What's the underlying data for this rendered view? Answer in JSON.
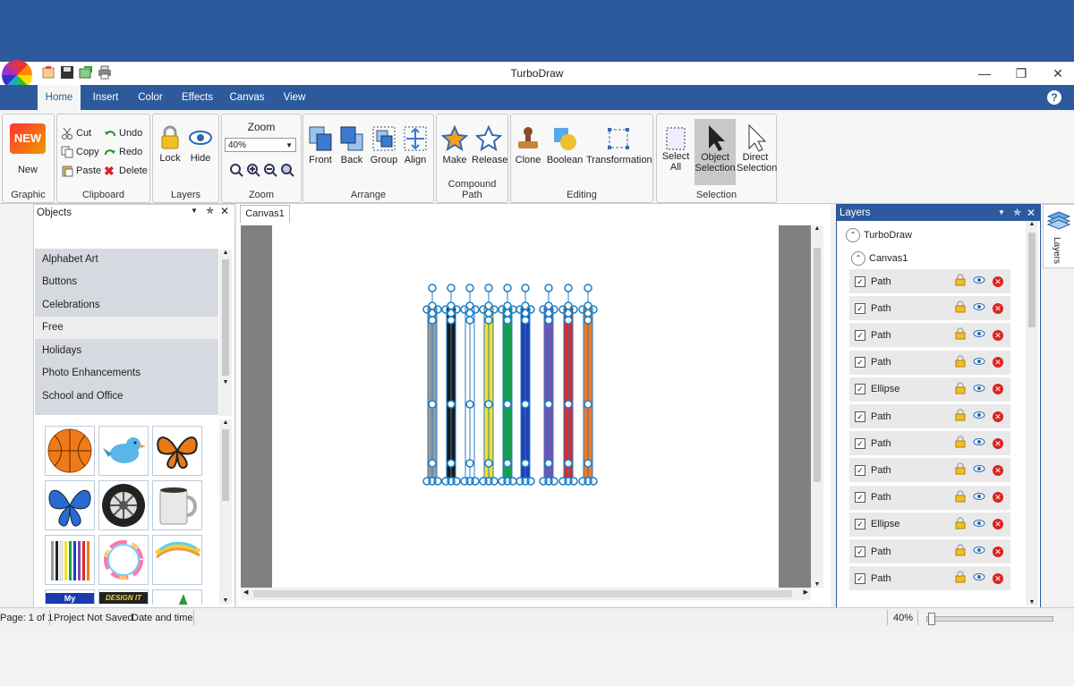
{
  "app": {
    "title": "TurboDraw"
  },
  "tabs": [
    "Home",
    "Insert",
    "Color",
    "Effects",
    "Canvas",
    "View"
  ],
  "ribbon": {
    "graphic": {
      "label": "Graphic",
      "new_label": "New",
      "badge": "NEW"
    },
    "clipboard": {
      "label": "Clipboard",
      "cut": "Cut",
      "copy": "Copy",
      "paste": "Paste",
      "undo": "Undo",
      "redo": "Redo",
      "delete": "Delete"
    },
    "layers": {
      "label": "Layers",
      "lock": "Lock",
      "hide": "Hide"
    },
    "zoom": {
      "label": "Zoom",
      "title": "Zoom",
      "value": "40%"
    },
    "arrange": {
      "label": "Arrange",
      "front": "Front",
      "back": "Back",
      "group": "Group",
      "align": "Align"
    },
    "compound": {
      "label": "Compound Path",
      "make": "Make",
      "release": "Release"
    },
    "editing": {
      "label": "Editing",
      "clone": "Clone",
      "boolean": "Boolean",
      "transformation": "Transformation"
    },
    "selection": {
      "label": "Selection",
      "select_all_1": "Select",
      "select_all_2": "All",
      "object_sel_1": "Object",
      "object_sel_2": "Selection",
      "direct_sel_1": "Direct",
      "direct_sel_2": "Selection"
    }
  },
  "objects_panel": {
    "title": "Objects",
    "categories": [
      "Alphabet Art",
      "Buttons",
      "Celebrations",
      "Free",
      "Holidays",
      "Photo Enhancements",
      "School and Office"
    ],
    "selected_category": "Free",
    "thumbs": [
      "basketball",
      "bird",
      "monarch-butterfly",
      "blue-butterfly",
      "tire",
      "mug",
      "pencils",
      "color-ring",
      "paint-stroke",
      "logo",
      "design-logo",
      "leaf"
    ],
    "thumb_texts": {
      "logo": "My",
      "design": "DESIGN IT"
    }
  },
  "canvas": {
    "tab": "Canvas1",
    "pencil_colors": [
      "#9a9a9a",
      "#1b1b1b",
      "#ffffff",
      "#f0e22a",
      "#16a244",
      "#1f3fb8",
      "#7a4fb0",
      "#e02727",
      "#f07a25"
    ]
  },
  "layers_panel": {
    "title": "Layers",
    "side_tab": "Layers",
    "root": "TurboDraw",
    "canvas": "Canvas1",
    "items": [
      "Path",
      "Path",
      "Path",
      "Path",
      "Ellipse",
      "Path",
      "Path",
      "Path",
      "Path",
      "Ellipse",
      "Path",
      "Path"
    ]
  },
  "status": {
    "page": "Page: 1 of 1",
    "project": "Project Not Saved",
    "datetime": "Date and time",
    "zoom": "40%",
    "slider_value": 0.01
  },
  "colors": {
    "brand": "#2c5a9c",
    "accent": "#1a7fc4"
  }
}
